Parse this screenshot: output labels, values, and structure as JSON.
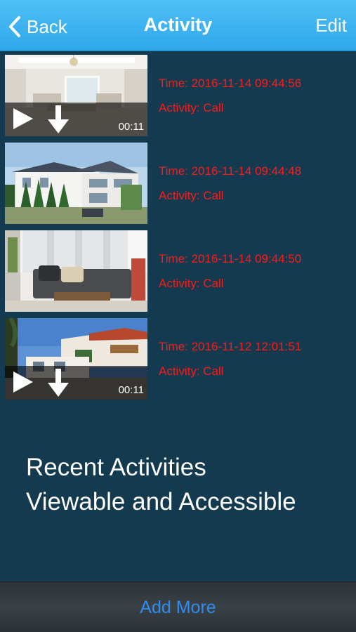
{
  "navbar": {
    "back_label": "Back",
    "title": "Activity",
    "edit_label": "Edit"
  },
  "activities": [
    {
      "time": "Time: 2016-11-14 09:44:56",
      "activity": "Activity: Call",
      "duration": "00:11",
      "has_video": true,
      "scene": "living-room"
    },
    {
      "time": "Time: 2016-11-14 09:44:48",
      "activity": "Activity: Call",
      "duration": "",
      "has_video": false,
      "scene": "house"
    },
    {
      "time": "Time: 2016-11-14 09:44:50",
      "activity": "Activity: Call",
      "duration": "",
      "has_video": false,
      "scene": "sofa-room"
    },
    {
      "time": "Time: 2016-11-12 12:01:51",
      "activity": "Activity: Call",
      "duration": "00:11",
      "has_video": true,
      "scene": "villa"
    }
  ],
  "promo": {
    "line1": "Recent Activities",
    "line2": "Viewable and Accessible"
  },
  "footer": {
    "add_more_label": "Add More"
  },
  "colors": {
    "accent": "#2fa7ea",
    "background": "#133a4e",
    "activity_text": "#ff1a1a",
    "link": "#2f8cf2"
  }
}
